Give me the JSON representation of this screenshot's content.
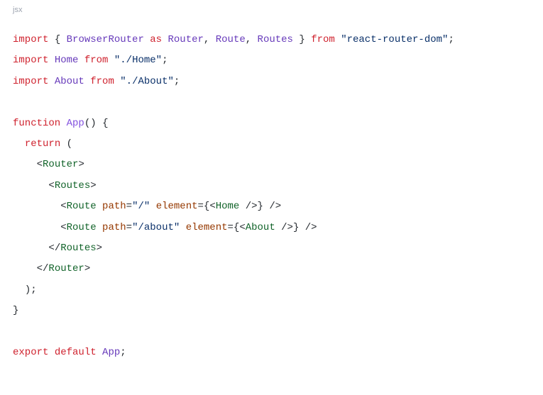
{
  "language_label": "jsx",
  "code_tokens": {
    "k_import": "import",
    "k_from": "from",
    "k_as": "as",
    "k_function": "function",
    "k_return": "return",
    "k_export": "export",
    "k_default": "default",
    "cls_BrowserRouter": "BrowserRouter",
    "cls_Router": "Router",
    "cls_Route": "Route",
    "cls_Routes": "Routes",
    "cls_Home": "Home",
    "cls_About": "About",
    "fn_App": "App",
    "str_react_router_dom": "\"react-router-dom\"",
    "str_home_path": "\"./Home\"",
    "str_about_path": "\"./About\"",
    "str_root": "\"/\"",
    "str_about_route": "\"/about\"",
    "attr_path": "path",
    "attr_element": "element",
    "p_obrace": "{",
    "p_cbrace": "}",
    "p_comma": ",",
    "p_semi": ";",
    "p_oparen": "(",
    "p_cparen": ")",
    "p_lt": "<",
    "p_gt": ">",
    "p_slashgt": "/>",
    "p_ltslash": "</",
    "p_eq": "=",
    "p_sp": " "
  }
}
